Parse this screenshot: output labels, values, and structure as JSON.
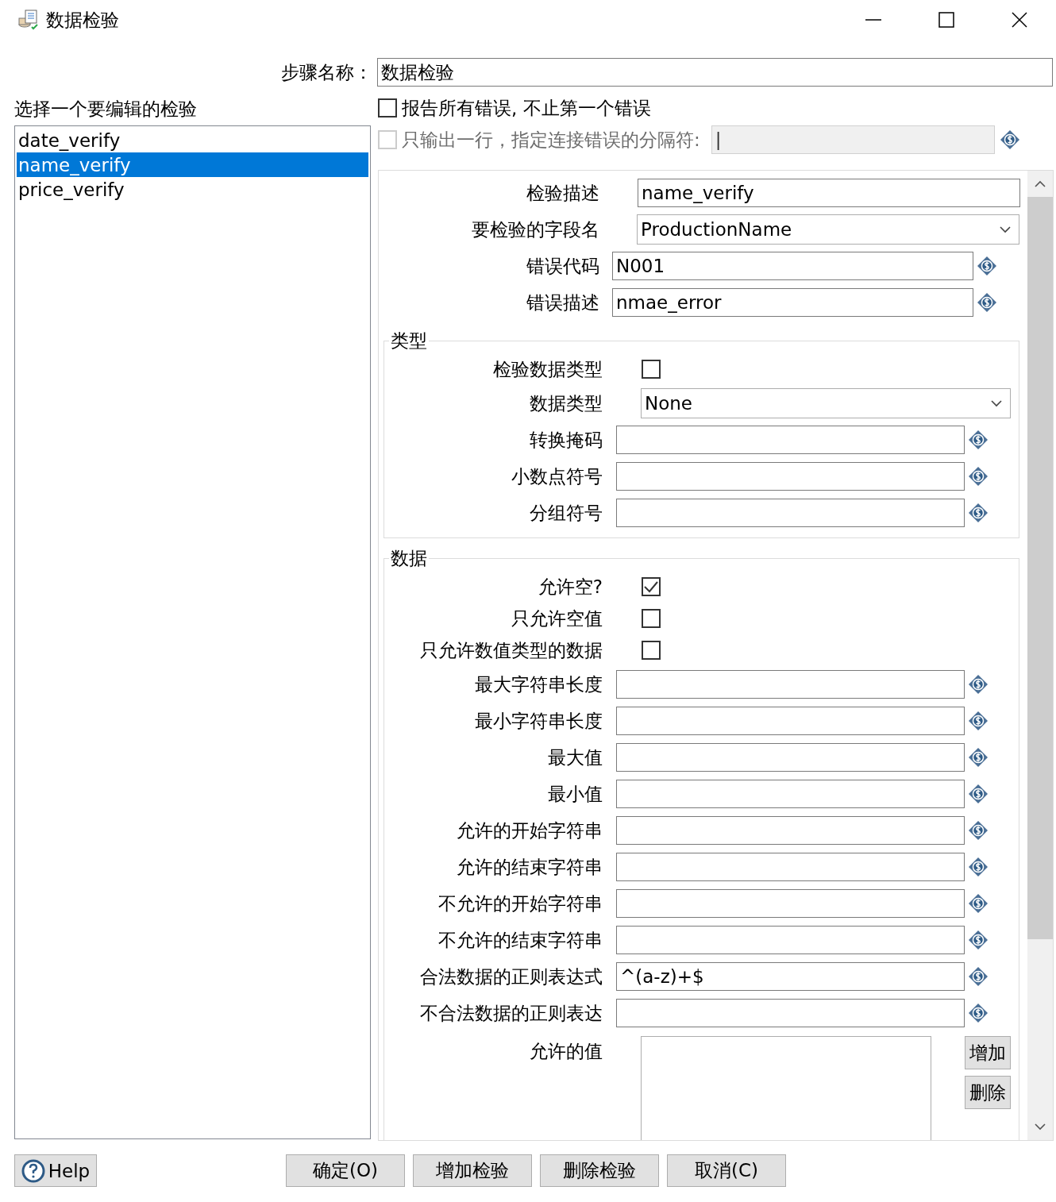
{
  "window": {
    "title": "数据检验"
  },
  "step_name": {
    "label": "步骤名称：",
    "value": "数据检验"
  },
  "validations": {
    "label": "选择一个要编辑的检验",
    "items": [
      {
        "name": "date_verify",
        "selected": false
      },
      {
        "name": "name_verify",
        "selected": true
      },
      {
        "name": "price_verify",
        "selected": false
      }
    ]
  },
  "options": [
    {
      "label": "报告所有错误, 不止第一个错误",
      "checked": false,
      "disabled": false
    },
    {
      "label": "只输出一行，指定连接错误的分隔符:",
      "checked": false,
      "disabled": true,
      "value": "|"
    }
  ],
  "general": [
    {
      "kind": "text",
      "label": "检验描述",
      "value": "name_verify"
    },
    {
      "kind": "select",
      "label": "要检验的字段名",
      "value": "ProductionName"
    },
    {
      "kind": "variable",
      "label": "错误代码",
      "value": "N001"
    },
    {
      "kind": "variable",
      "label": "错误描述",
      "value": "nmae_error"
    }
  ],
  "groups": [
    {
      "title": "类型",
      "fields": [
        {
          "kind": "checkbox",
          "label": "检验数据类型",
          "checked": false
        },
        {
          "kind": "select",
          "label": "数据类型",
          "value": "None"
        },
        {
          "kind": "variable",
          "label": "转换掩码"
        },
        {
          "kind": "variable",
          "label": "小数点符号"
        },
        {
          "kind": "variable",
          "label": "分组符号"
        }
      ]
    },
    {
      "title": "数据",
      "fields": [
        {
          "kind": "checkbox",
          "label": "允许空?",
          "checked": true
        },
        {
          "kind": "checkbox",
          "label": "只允许空值",
          "checked": false
        },
        {
          "kind": "checkbox",
          "label": "只允许数值类型的数据",
          "checked": false
        },
        {
          "kind": "variable",
          "label": "最大字符串长度"
        },
        {
          "kind": "variable",
          "label": "最小字符串长度"
        },
        {
          "kind": "variable",
          "label": "最大值"
        },
        {
          "kind": "variable",
          "label": "最小值"
        },
        {
          "kind": "variable",
          "label": "允许的开始字符串"
        },
        {
          "kind": "variable",
          "label": "允许的结束字符串"
        },
        {
          "kind": "variable",
          "label": "不允许的开始字符串"
        },
        {
          "kind": "variable",
          "label": "不允许的结束字符串"
        },
        {
          "kind": "variable",
          "label": "合法数据的正则表达式",
          "value": "^(a-z)+$"
        },
        {
          "kind": "variable",
          "label": "不合法数据的正则表达"
        },
        {
          "kind": "list",
          "label": "允许的值",
          "buttons": [
            "增加",
            "删除"
          ]
        }
      ]
    }
  ],
  "buttons": [
    {
      "kind": "help",
      "label": "Help"
    },
    {
      "kind": "plain",
      "label": "确定(O)"
    },
    {
      "kind": "plain",
      "label": "增加检验"
    },
    {
      "kind": "plain",
      "label": "删除检验"
    },
    {
      "kind": "plain",
      "label": "取消(C)"
    }
  ]
}
